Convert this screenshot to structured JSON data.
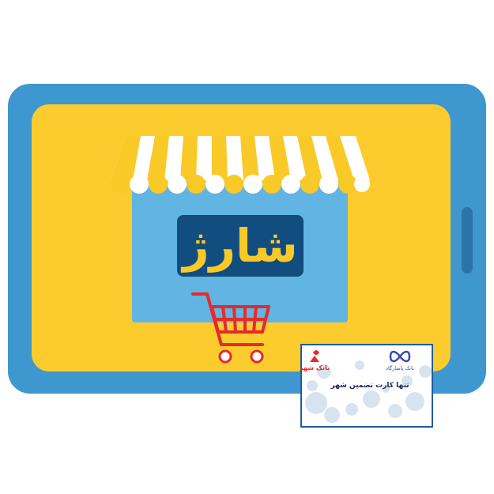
{
  "storefront": {
    "sign_text": "شارژ"
  },
  "card": {
    "title": "تنها کارت تضمین شهر",
    "bank_logo_text": "بانک شهر",
    "partner_logo_text": "بانک پاسارگاد"
  },
  "colors": {
    "tablet_frame": "#3f97cf",
    "tablet_screen": "#fccc2e",
    "shop_body": "#62b4e2",
    "awning_yellow": "#f9c928",
    "awning_white": "#ffffff",
    "sign_bg": "#124d7f",
    "sign_text": "#f9c928",
    "cart": "#e52b2b",
    "card_border": "#1f5e9b"
  }
}
